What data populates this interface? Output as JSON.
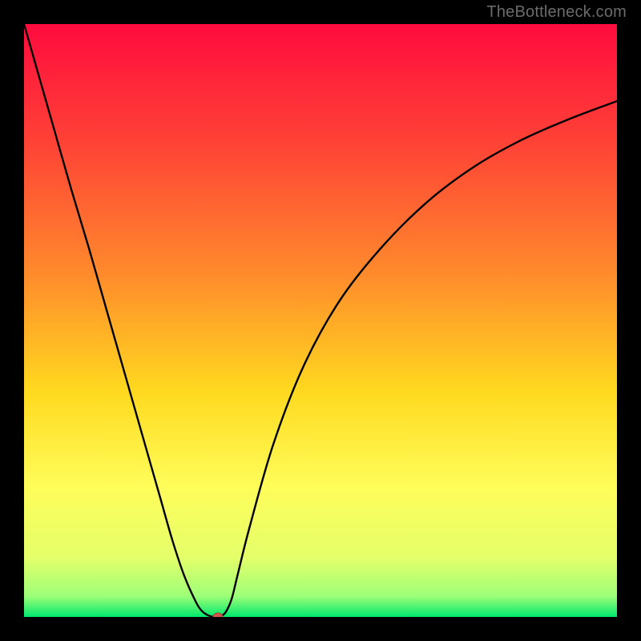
{
  "watermark": "TheBottleneck.com",
  "chart_data": {
    "type": "line",
    "title": "",
    "xlabel": "",
    "ylabel": "",
    "xlim": [
      0,
      100
    ],
    "ylim": [
      0,
      100
    ],
    "x": [
      0,
      2,
      5,
      8,
      11,
      14,
      17,
      20,
      23,
      25,
      27,
      29,
      30,
      31,
      32,
      33,
      34,
      35,
      36,
      38,
      42,
      47,
      53,
      60,
      68,
      76,
      84,
      92,
      100
    ],
    "values": [
      100,
      93,
      82.5,
      72,
      62,
      51.5,
      41,
      30.5,
      20,
      13,
      7,
      2.5,
      1,
      0.3,
      0,
      0,
      0.8,
      3,
      7,
      15,
      29,
      42,
      53,
      62,
      70,
      76,
      80.5,
      84,
      87
    ],
    "minimum_marker": {
      "x": 32.7,
      "y": 0
    },
    "gradient_stops": [
      {
        "offset": 0.0,
        "color": "#ff0b3e"
      },
      {
        "offset": 0.2,
        "color": "#ff4236"
      },
      {
        "offset": 0.42,
        "color": "#ff8a2c"
      },
      {
        "offset": 0.62,
        "color": "#ffd91f"
      },
      {
        "offset": 0.78,
        "color": "#fffd5a"
      },
      {
        "offset": 0.9,
        "color": "#e4ff6a"
      },
      {
        "offset": 0.965,
        "color": "#9dff78"
      },
      {
        "offset": 1.0,
        "color": "#00e86c"
      }
    ]
  }
}
